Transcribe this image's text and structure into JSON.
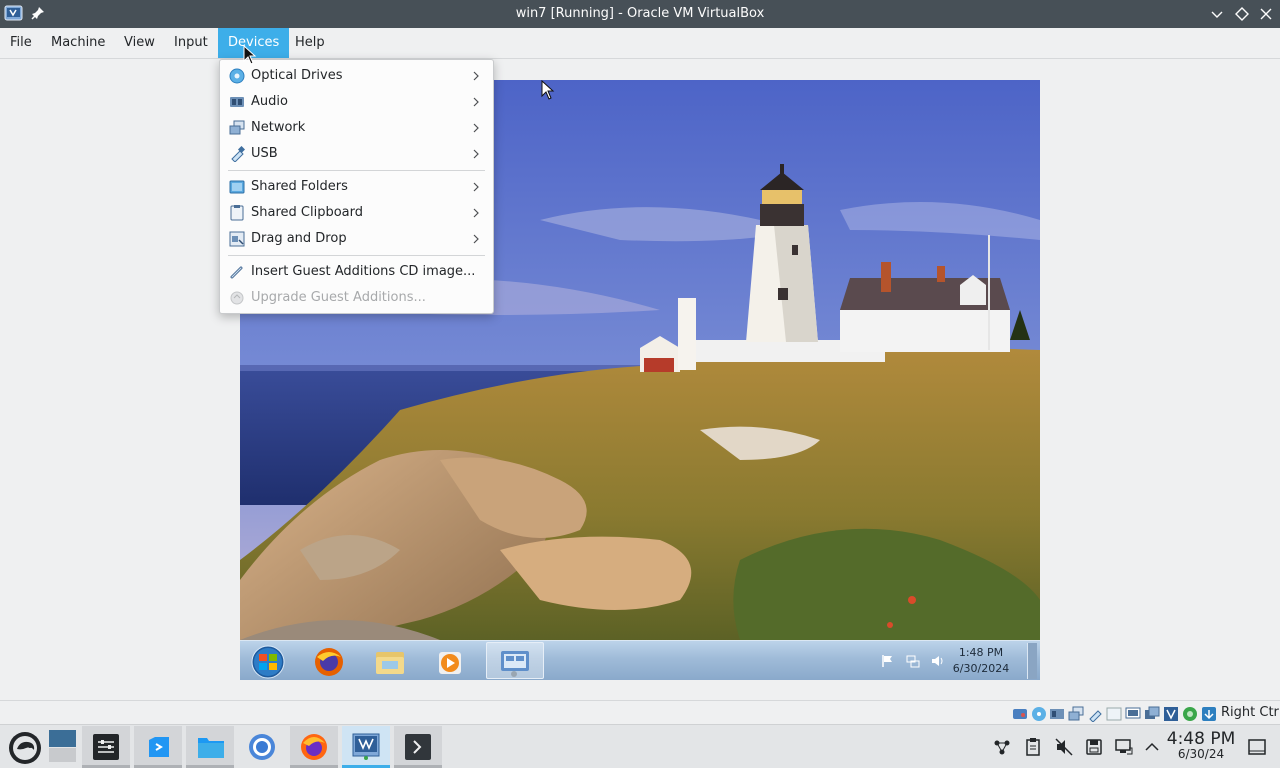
{
  "window": {
    "title": "win7 [Running] - Oracle VM VirtualBox"
  },
  "menubar": {
    "items": [
      {
        "label": "File"
      },
      {
        "label": "Machine"
      },
      {
        "label": "View"
      },
      {
        "label": "Input"
      },
      {
        "label": "Devices",
        "active": true
      },
      {
        "label": "Help"
      }
    ]
  },
  "devices_menu": {
    "items": [
      {
        "label": "Optical Drives",
        "icon": "optical-drive-icon",
        "submenu": true
      },
      {
        "label": "Audio",
        "icon": "audio-icon",
        "submenu": true
      },
      {
        "label": "Network",
        "icon": "network-icon",
        "submenu": true
      },
      {
        "label": "USB",
        "icon": "usb-icon",
        "submenu": true
      },
      {
        "label": "Shared Folders",
        "icon": "shared-folders-icon",
        "submenu": true
      },
      {
        "label": "Shared Clipboard",
        "icon": "clipboard-icon",
        "submenu": true
      },
      {
        "label": "Drag and Drop",
        "icon": "drag-drop-icon",
        "submenu": true
      },
      {
        "label": "Insert Guest Additions CD image...",
        "icon": "guest-additions-icon",
        "submenu": false
      },
      {
        "label": "Upgrade Guest Additions...",
        "icon": "upgrade-icon",
        "submenu": false,
        "disabled": true
      }
    ]
  },
  "guest": {
    "wallpaper": "lighthouse-on-rocky-coast",
    "taskbar": {
      "pinned": [
        "windows-start-orb",
        "firefox-icon",
        "file-explorer-icon",
        "media-player-icon",
        "virtualbox-vm-icon"
      ],
      "clock_time": "1:48 PM",
      "clock_date": "6/30/2024"
    }
  },
  "statusbar": {
    "host_key": "Right Ctrl"
  },
  "panel": {
    "clock_time": "4:48 PM",
    "clock_date": "6/30/24"
  },
  "colors": {
    "accent": "#3daee9",
    "titlebar": "#475057",
    "menu_bg": "#fcfcfc"
  }
}
